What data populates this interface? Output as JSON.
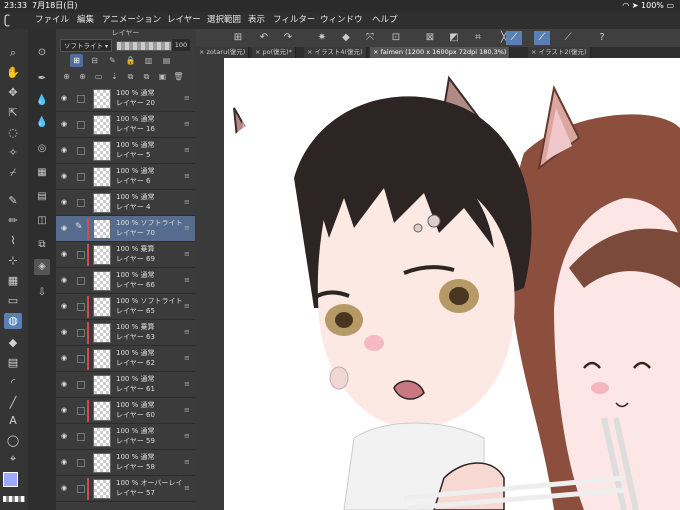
{
  "status_bar": {
    "time": "23:33",
    "date": "7月18日(日)",
    "battery": "100%"
  },
  "menu": {
    "logo": "clip-studio-logo",
    "items": [
      "ファイル",
      "編集",
      "アニメーション",
      "レイヤー",
      "選択範囲",
      "表示",
      "フィルター",
      "ウィンドウ",
      "ヘルプ"
    ]
  },
  "layer_panel": {
    "title": "レイヤー",
    "blend_mode": "ソフトライト",
    "opacity": "100",
    "layers": [
      {
        "opacity_blend": "100 % 通常",
        "name": "レイヤー 20",
        "clipped": false,
        "selected": false
      },
      {
        "opacity_blend": "100 % 通常",
        "name": "レイヤー 16",
        "clipped": false,
        "selected": false
      },
      {
        "opacity_blend": "100 % 通常",
        "name": "レイヤー 5",
        "clipped": false,
        "selected": false
      },
      {
        "opacity_blend": "100 % 通常",
        "name": "レイヤー 6",
        "clipped": false,
        "selected": false
      },
      {
        "opacity_blend": "100 % 通常",
        "name": "レイヤー 4",
        "clipped": false,
        "selected": false
      },
      {
        "opacity_blend": "100 % ソフトライト",
        "name": "レイヤー 70",
        "clipped": true,
        "selected": true
      },
      {
        "opacity_blend": "100 % 乗算",
        "name": "レイヤー 69",
        "clipped": true,
        "selected": false
      },
      {
        "opacity_blend": "100 % 通常",
        "name": "レイヤー 66",
        "clipped": false,
        "selected": false
      },
      {
        "opacity_blend": "100 % ソフトライト",
        "name": "レイヤー 65",
        "clipped": true,
        "selected": false
      },
      {
        "opacity_blend": "100 % 乗算",
        "name": "レイヤー 63",
        "clipped": true,
        "selected": false
      },
      {
        "opacity_blend": "100 % 通常",
        "name": "レイヤー 62",
        "clipped": true,
        "selected": false
      },
      {
        "opacity_blend": "100 % 通常",
        "name": "レイヤー 61",
        "clipped": false,
        "selected": false
      },
      {
        "opacity_blend": "100 % 通常",
        "name": "レイヤー 60",
        "clipped": true,
        "selected": false
      },
      {
        "opacity_blend": "100 % 通常",
        "name": "レイヤー 59",
        "clipped": false,
        "selected": false
      },
      {
        "opacity_blend": "100 % 通常",
        "name": "レイヤー 58",
        "clipped": false,
        "selected": false
      },
      {
        "opacity_blend": "100 % オーバーレイ",
        "name": "レイヤー 57",
        "clipped": true,
        "selected": false
      }
    ]
  },
  "tabs": [
    {
      "label": "zotaru(復元)",
      "active": false
    },
    {
      "label": "po(復元)*",
      "active": false
    },
    {
      "label": "イラスト4(復元)",
      "active": false
    },
    {
      "label": "faimen (1200 x 1600px 72dpi 180.3%)",
      "active": true
    },
    {
      "label": "イラスト2(復元)",
      "active": false
    }
  ],
  "colors": {
    "accent": "#5a7fb3",
    "selected_layer": "#566c8e",
    "clip_bar": "#d34b4b",
    "main_color": "#9ea8ff",
    "sub_color": "#ffffff"
  }
}
